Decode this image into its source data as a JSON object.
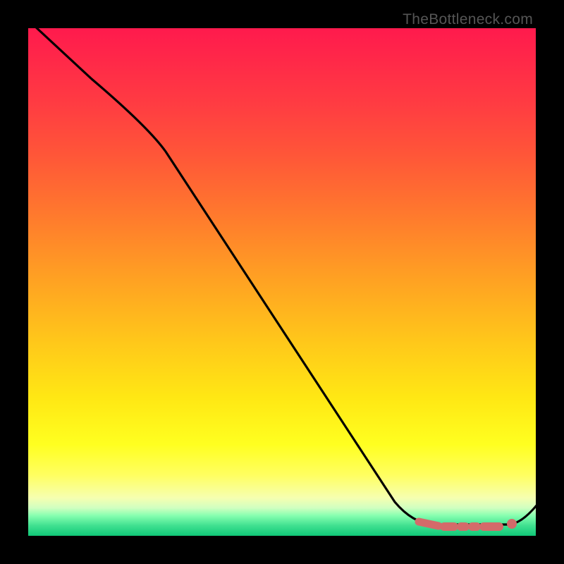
{
  "attribution": "TheBottleneck.com",
  "colors": {
    "curve": "#000000",
    "flat_marker": "#d46a6a",
    "frame_bg": "#000000"
  },
  "chart_data": {
    "type": "line",
    "title": "",
    "xlabel": "",
    "ylabel": "",
    "xlim": [
      0,
      100
    ],
    "ylim": [
      0,
      100
    ],
    "grid": false,
    "legend": false,
    "series": [
      {
        "name": "bottleneck_curve",
        "x": [
          0,
          12,
          25,
          73,
          80,
          88,
          95,
          100
        ],
        "y": [
          100,
          90,
          80,
          6,
          2,
          2,
          2,
          7
        ]
      }
    ],
    "flat_region": {
      "x_start": 76,
      "x_end": 95,
      "y": 2
    },
    "marker_point": {
      "x": 95,
      "y": 2
    },
    "gradient_stops": [
      {
        "pct": 0,
        "color": "#ff1a4d"
      },
      {
        "pct": 50,
        "color": "#ffa322"
      },
      {
        "pct": 82,
        "color": "#ffff20"
      },
      {
        "pct": 100,
        "color": "#10c878"
      }
    ]
  }
}
